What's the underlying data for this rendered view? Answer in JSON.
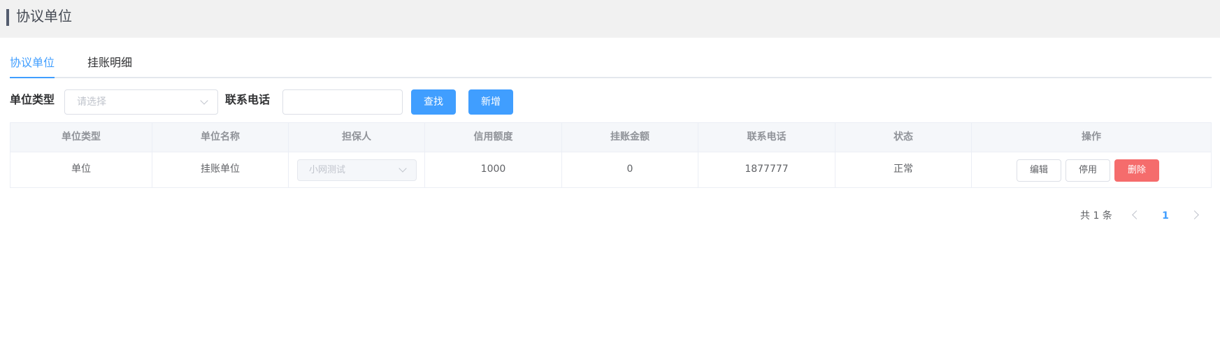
{
  "header": {
    "title": "协议单位"
  },
  "tabs": [
    {
      "label": "协议单位",
      "active": true
    },
    {
      "label": "挂账明细",
      "active": false
    }
  ],
  "filters": {
    "unit_type_label": "单位类型",
    "unit_type_placeholder": "请选择",
    "phone_label": "联系电话",
    "phone_value": "",
    "search_button": "查找",
    "add_button": "新增"
  },
  "table": {
    "columns": [
      "单位类型",
      "单位名称",
      "担保人",
      "信用额度",
      "挂账金额",
      "联系电话",
      "状态",
      "操作"
    ],
    "rows": [
      {
        "unit_type": "单位",
        "unit_name": "挂账单位",
        "guarantor": "小网测试",
        "credit_limit": "1000",
        "credit_amount": "0",
        "phone": "1877777",
        "status": "正常",
        "actions": {
          "edit": "编辑",
          "disable": "停用",
          "delete": "删除"
        }
      }
    ]
  },
  "pagination": {
    "total_text": "共 1 条",
    "current_page": "1"
  },
  "colors": {
    "accent": "#409eff",
    "danger": "#f56c6c",
    "header_bg": "#f1f1f1",
    "table_header_bg": "#f5f7fa"
  },
  "icons": {
    "header_bar": "vertical-bar-accent",
    "select_arrow": "chevron-down-icon",
    "pager_prev": "chevron-left-icon",
    "pager_next": "chevron-right-icon"
  }
}
